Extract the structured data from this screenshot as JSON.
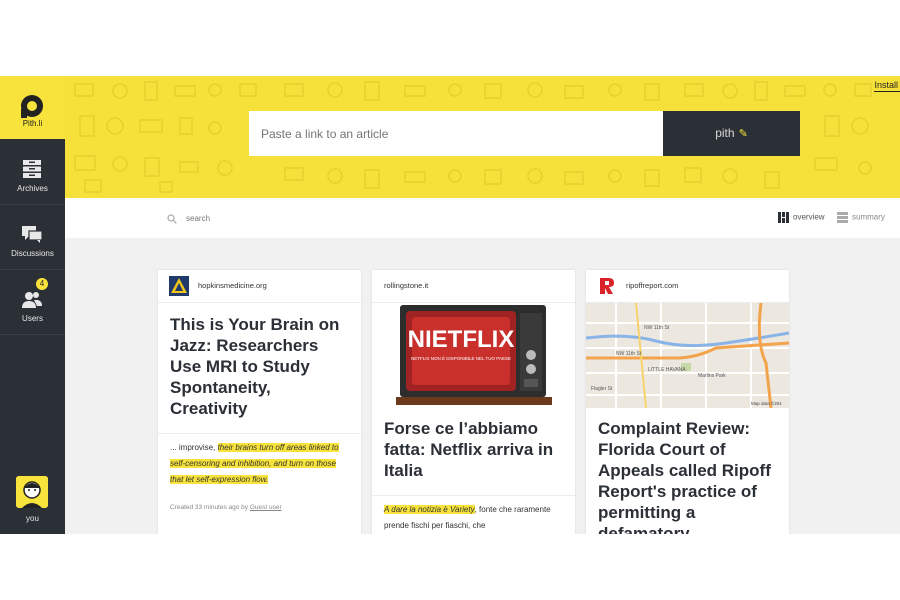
{
  "app": {
    "name": "Pith.li",
    "install_label": "Install"
  },
  "sidebar": {
    "items": [
      {
        "label": "Archives",
        "icon": "archives-icon"
      },
      {
        "label": "Discussions",
        "icon": "discussions-icon"
      },
      {
        "label": "Users",
        "icon": "users-icon",
        "badge": "4"
      }
    ],
    "user_label": "you"
  },
  "header": {
    "url_placeholder": "Paste a link to an article",
    "submit_label": "pith",
    "submit_icon": "pencil-icon"
  },
  "toolbar": {
    "search_placeholder": "search",
    "views": [
      {
        "label": "overview",
        "icon": "grid-icon",
        "active": true
      },
      {
        "label": "summary",
        "icon": "list-icon",
        "active": false
      }
    ]
  },
  "cards": [
    {
      "source": "hopkinsmedicine.org",
      "title": "This is Your Brain on Jazz: Researchers Use MRI to Study Spontaneity, Creativity",
      "excerpt_plain": "... improvise, ",
      "excerpt_highlight": "their brains turn off areas linked to self-censoring and inhibition, and turn on those that let self-expression flow.",
      "meta_prefix": "Created 33 minutes ago by ",
      "meta_user": "Guest user"
    },
    {
      "source": "rollingstone.it",
      "image_text": "NIETFLIX",
      "image_subtext": "NETFLIX NON È DISPONIBILE NEL TUO PAESE",
      "title": "Forse ce l’abbiamo fatta: Netflix arriva in Italia",
      "excerpt_highlight": "A dare la notizia è Variety",
      "excerpt_plain": ", fonte che raramente prende fischi per fiaschi, che"
    },
    {
      "source": "ripoffreport.com",
      "map_labels": [
        "NW 11th St",
        "NW 11th St",
        "LITTLE HAVANA",
        "Marlins Park",
        "Flagler St",
        "Map data ©201"
      ],
      "title": "Complaint Review: Florida Court of Appeals called Ripoff Report's practice of permitting a defamatory"
    }
  ],
  "colors": {
    "accent": "#f7e33b",
    "dark": "#2b2f36"
  }
}
